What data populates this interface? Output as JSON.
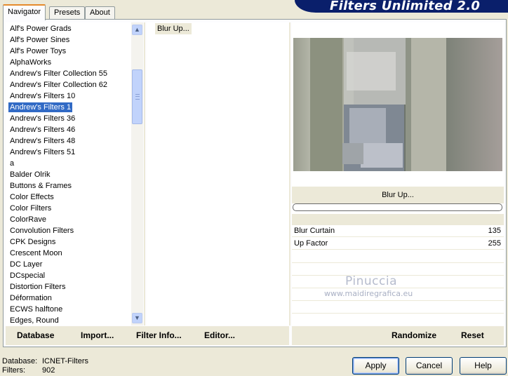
{
  "window": {
    "title": "Filters Unlimited 2.0"
  },
  "tabs": [
    {
      "label": "Navigator",
      "active": true
    },
    {
      "label": "Presets",
      "active": false
    },
    {
      "label": "About",
      "active": false
    }
  ],
  "filter_list": {
    "selected_index": 7,
    "items": [
      "Alf's Power Grads",
      "Alf's Power Sines",
      "Alf's Power Toys",
      "AlphaWorks",
      "Andrew's Filter Collection 55",
      "Andrew's Filter Collection 62",
      "Andrew's Filters 10",
      "Andrew's Filters 1",
      "Andrew's Filters 36",
      "Andrew's Filters 46",
      "Andrew's Filters 48",
      "Andrew's Filters 51",
      "a",
      "Balder Olrik",
      "Buttons & Frames",
      "Color Effects",
      "Color Filters",
      "ColorRave",
      "Convolution Filters",
      "CPK Designs",
      "Crescent Moon",
      "DC Layer",
      "DCspecial",
      "Distortion Filters",
      "Déformation",
      "ECWS halftone",
      "Edges, Round"
    ]
  },
  "effect_list": {
    "items": [
      "Blur Up..."
    ]
  },
  "preview": {
    "effect_title": "Blur Up...",
    "progress": 0,
    "params": [
      {
        "name": "Blur Curtain",
        "value": "135"
      },
      {
        "name": "Up Factor",
        "value": "255"
      }
    ],
    "watermark": {
      "name": "Pinuccia",
      "url": "www.maidiregrafica.eu"
    }
  },
  "left_buttons": {
    "database": "Database",
    "import": "Import...",
    "filter_info": "Filter Info...",
    "editor": "Editor..."
  },
  "right_buttons": {
    "randomize": "Randomize",
    "reset": "Reset"
  },
  "status": {
    "database_label": "Database:",
    "database_value": "ICNET-Filters",
    "filters_label": "Filters:",
    "filters_value": "902"
  },
  "dialog_buttons": {
    "apply": "Apply",
    "cancel": "Cancel",
    "help": "Help"
  },
  "colors": {
    "banner": "#0a1f6b",
    "selection": "#316ac5",
    "face": "#ece9d8"
  }
}
